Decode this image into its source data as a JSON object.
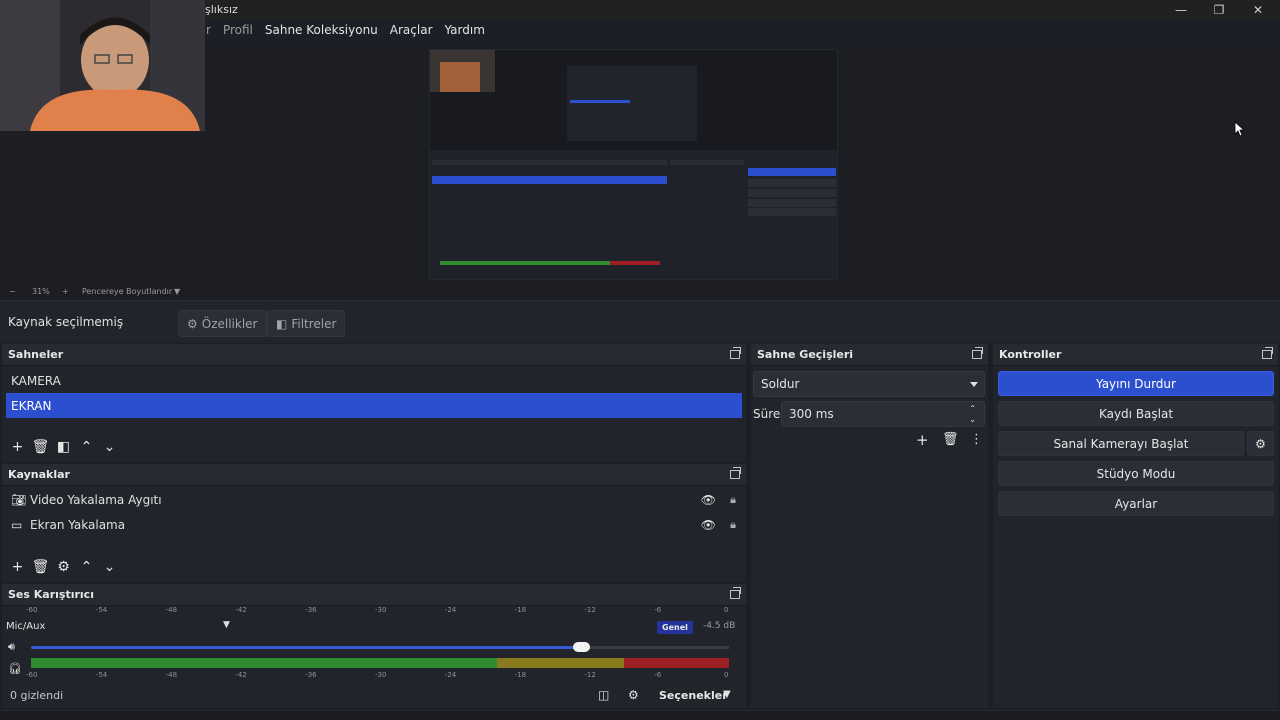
{
  "window": {
    "title": "şlıksız",
    "controls": {
      "minimize": "—",
      "maximize": "❐",
      "close": "✕"
    }
  },
  "menu": {
    "items": [
      {
        "label": "r",
        "dim": true
      },
      {
        "label": "Profil",
        "dim": true
      },
      {
        "label": "Sahne Koleksiyonu",
        "dim": false
      },
      {
        "label": "Araçlar",
        "dim": false
      },
      {
        "label": "Yardım",
        "dim": false
      }
    ]
  },
  "preview": {
    "zoom_minus": "−",
    "zoom_value": "31%",
    "zoom_plus": "+",
    "fit_mode": "Pencereye Boyutlandır"
  },
  "source_toolbar": {
    "status": "Kaynak seçilmemiş",
    "properties_label": "Özellikler",
    "filters_label": "Filtreler"
  },
  "scenes": {
    "title": "Sahneler",
    "items": [
      {
        "label": "KAMERA",
        "selected": false
      },
      {
        "label": "EKRAN",
        "selected": true
      }
    ]
  },
  "sources": {
    "title": "Kaynaklar",
    "items": [
      {
        "label": "Video Yakalama Aygıtı",
        "icon": "camera-icon"
      },
      {
        "label": "Ekran Yakalama",
        "icon": "monitor-icon"
      }
    ]
  },
  "transitions": {
    "title": "Sahne Geçişleri",
    "selected": "Soldur",
    "duration_label": "Süre",
    "duration_value": "300 ms"
  },
  "controls": {
    "title": "Kontroller",
    "stop_stream": "Yayını Durdur",
    "start_record": "Kaydı Başlat",
    "start_virtualcam": "Sanal Kamerayı Başlat",
    "studio_mode": "Stüdyo Modu",
    "settings": "Ayarlar"
  },
  "mixer": {
    "title": "Ses Karıştırıcı",
    "channel": "Mic/Aux",
    "badge": "Genel",
    "level": "-4.5 dB",
    "volume_fraction": 0.79,
    "scale": [
      "-60",
      "-54",
      "-48",
      "-42",
      "-36",
      "-30",
      "-24",
      "-18",
      "-12",
      "-6",
      "0"
    ],
    "hidden_count": "0 gizlendi",
    "options_label": "Seçenekler"
  },
  "colors": {
    "accent": "#2c4fd0",
    "meter_green": "#2e8b2e",
    "meter_yellow": "#8a7a1e",
    "meter_red": "#9e1f24"
  }
}
